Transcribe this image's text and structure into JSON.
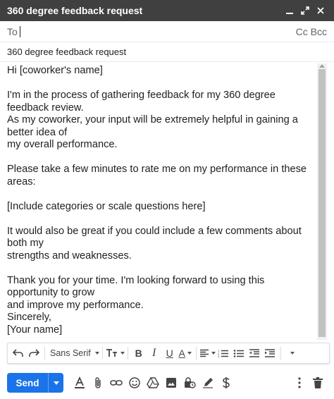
{
  "window": {
    "title": "360 degree feedback request",
    "controls": [
      "minimize-icon",
      "expand-icon",
      "close-icon"
    ]
  },
  "recipients": {
    "to_label": "To",
    "cc_bcc_label": "Cc Bcc"
  },
  "subject": "360 degree feedback request",
  "body": {
    "greeting": "Hi [coworker's name]",
    "p1_l1": "I'm in the process of gathering feedback for my 360 degree feedback review.",
    "p1_l2": "As my coworker, your input will be extremely helpful in gaining a better idea of",
    "p1_l3": "my overall performance.",
    "p2": "Please take a few minutes to rate me on my performance in these areas:",
    "p3": "[Include categories or scale questions here]",
    "p4_l1": "It would also be great if you could include a few comments about both my",
    "p4_l2": "strengths and weaknesses.",
    "p5_l1": "Thank you for your time. I'm looking forward to using this opportunity to grow",
    "p5_l2": "and improve my performance.",
    "closing": "Sincerely,",
    "signature": "[Your name]"
  },
  "formatting": {
    "font": "Sans Serif",
    "bold": "B",
    "italic": "I",
    "underline": "U",
    "text_color": "A"
  },
  "bottom": {
    "send_label": "Send",
    "accent_color": "#1a73e8"
  }
}
